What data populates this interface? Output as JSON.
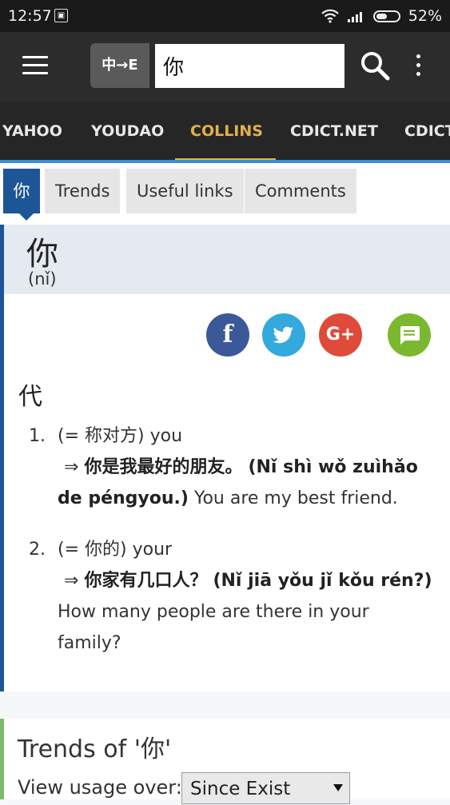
{
  "status": {
    "time": "12:57",
    "battery": "52%",
    "battery_level": 52
  },
  "toolbar": {
    "lang_label": "中→E",
    "search_value": "你"
  },
  "sources": [
    {
      "label": "YAHOO"
    },
    {
      "label": "YOUDAO"
    },
    {
      "label": "COLLINS"
    },
    {
      "label": "CDICT.NET"
    },
    {
      "label": "CDICT"
    }
  ],
  "active_source": "COLLINS",
  "subtabs": [
    {
      "label": "你"
    },
    {
      "label": "Trends"
    },
    {
      "label": "Useful links"
    },
    {
      "label": "Comments"
    }
  ],
  "entry": {
    "headword": "你",
    "pinyin": "(nǐ)",
    "share": {
      "facebook": "f",
      "google": "G+"
    },
    "part_of_speech": "代",
    "definitions": [
      {
        "num": "1.",
        "gloss": "(= 称对方) you",
        "arrow": "⇒",
        "example_zh": "你是我最好的朋友。",
        "example_pinyin": "(Nǐ shì wǒ zuìhǎo de péngyou.)",
        "example_en": "You are my best friend."
      },
      {
        "num": "2.",
        "gloss": "(= 你的) your",
        "arrow": "⇒",
        "example_zh": "你家有几口人？",
        "example_pinyin": "(Nǐ jiā yǒu jǐ kǒu rén?)",
        "example_en": "How many people are there in your family?"
      }
    ]
  },
  "trends": {
    "title": "Trends of '你'",
    "usage_label": "View usage over:",
    "usage_selected": "Since Exist"
  },
  "colors": {
    "accent": "#e0b24a",
    "entry_bar": "#1d5597",
    "trends_bar": "#7dbb6a",
    "facebook": "#3b5998",
    "twitter": "#33a9de",
    "google": "#e04a3a",
    "comment": "#7cb82f"
  }
}
